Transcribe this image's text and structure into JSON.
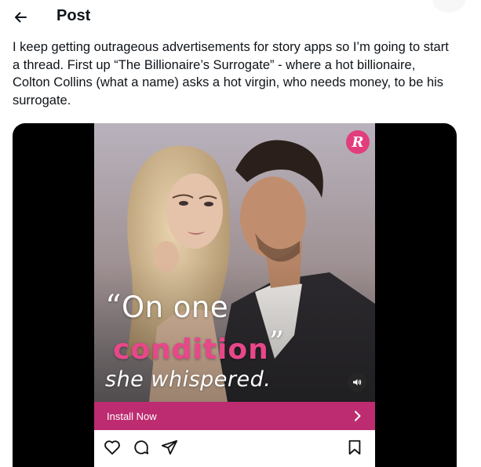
{
  "header": {
    "back_icon": "arrow-left-icon",
    "title": "Post"
  },
  "post": {
    "text": "I keep getting outrageous advertisements for story apps so I’m going to start a thread. First up “The Billionaire’s Surrogate” - where a hot billionaire, Colton Collins (what a name) asks a hot virgin, who needs money, to be his surrogate."
  },
  "ad": {
    "logo_letter": "R",
    "quote_open": "“",
    "quote_line1": "On one",
    "quote_line2": "condition",
    "quote_close": "”",
    "quote_line3": "she whispered.",
    "install_label": "Install Now",
    "colors": {
      "accent_pink": "#e8478a",
      "install_bar": "#bd2c71",
      "logo_bg": "#e23d7c"
    },
    "icons": {
      "sound": "speaker-icon",
      "chevron": "chevron-right-icon",
      "like": "heart-icon",
      "comment": "comment-bubble-icon",
      "share": "send-icon",
      "save": "bookmark-icon"
    }
  }
}
